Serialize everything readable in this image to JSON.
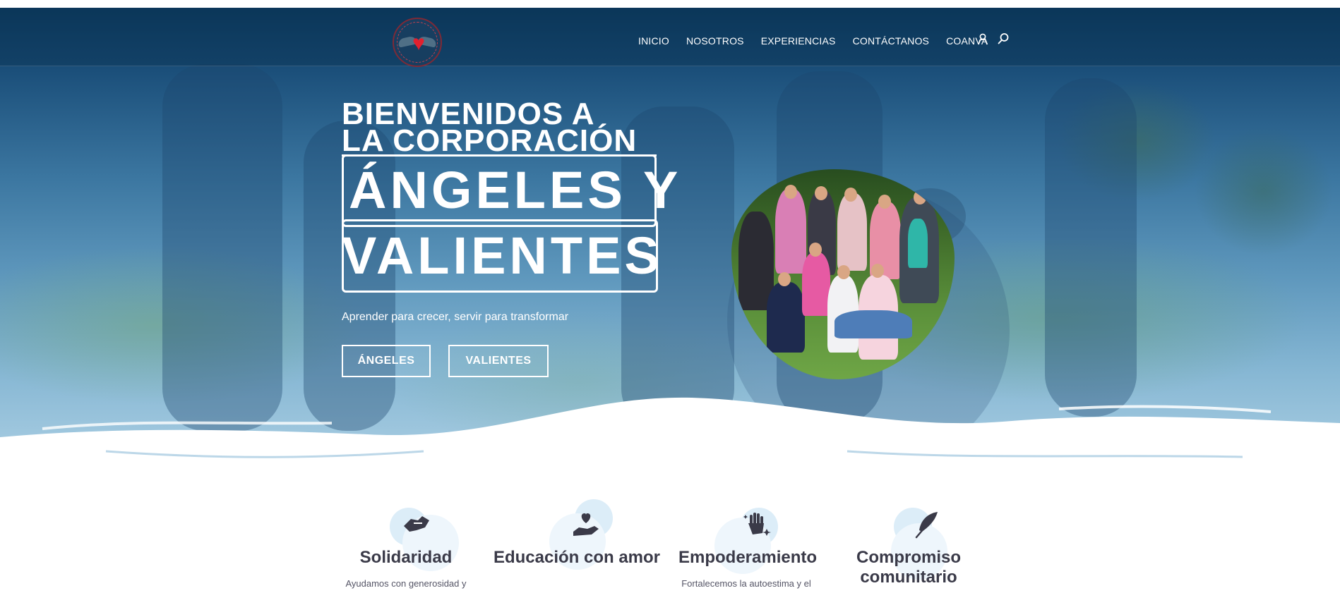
{
  "header": {
    "logo_name": "logo",
    "nav": [
      "INICIO",
      "NOSOTROS",
      "EXPERIENCIAS",
      "CONTÁCTANOS",
      "COANVA"
    ],
    "icons": [
      "user-icon",
      "search-icon"
    ]
  },
  "hero": {
    "line1": "BIENVENIDOS A",
    "line2": "LA CORPORACIÓN",
    "big1": "ÁNGELES Y",
    "big2": "VALIENTES",
    "tagline": "Aprender para crecer, servir para transformar",
    "buttons": [
      "ÁNGELES",
      "VALIENTES"
    ]
  },
  "features": [
    {
      "icon": "handshake-icon",
      "title": "Solidaridad",
      "text": "Ayudamos con generosidad y"
    },
    {
      "icon": "heart-hand-icon",
      "title": "Educación con amor",
      "text": ""
    },
    {
      "icon": "raised-hand-icon",
      "title": "Empoderamiento",
      "text": "Fortalecemos la autoestima y el"
    },
    {
      "icon": "feather-icon",
      "title": "Compromiso comunitario",
      "text": ""
    }
  ],
  "colors": {
    "navy": "#0e3d63",
    "accent_red": "#e2202e",
    "title_dark": "#3a3a48"
  }
}
